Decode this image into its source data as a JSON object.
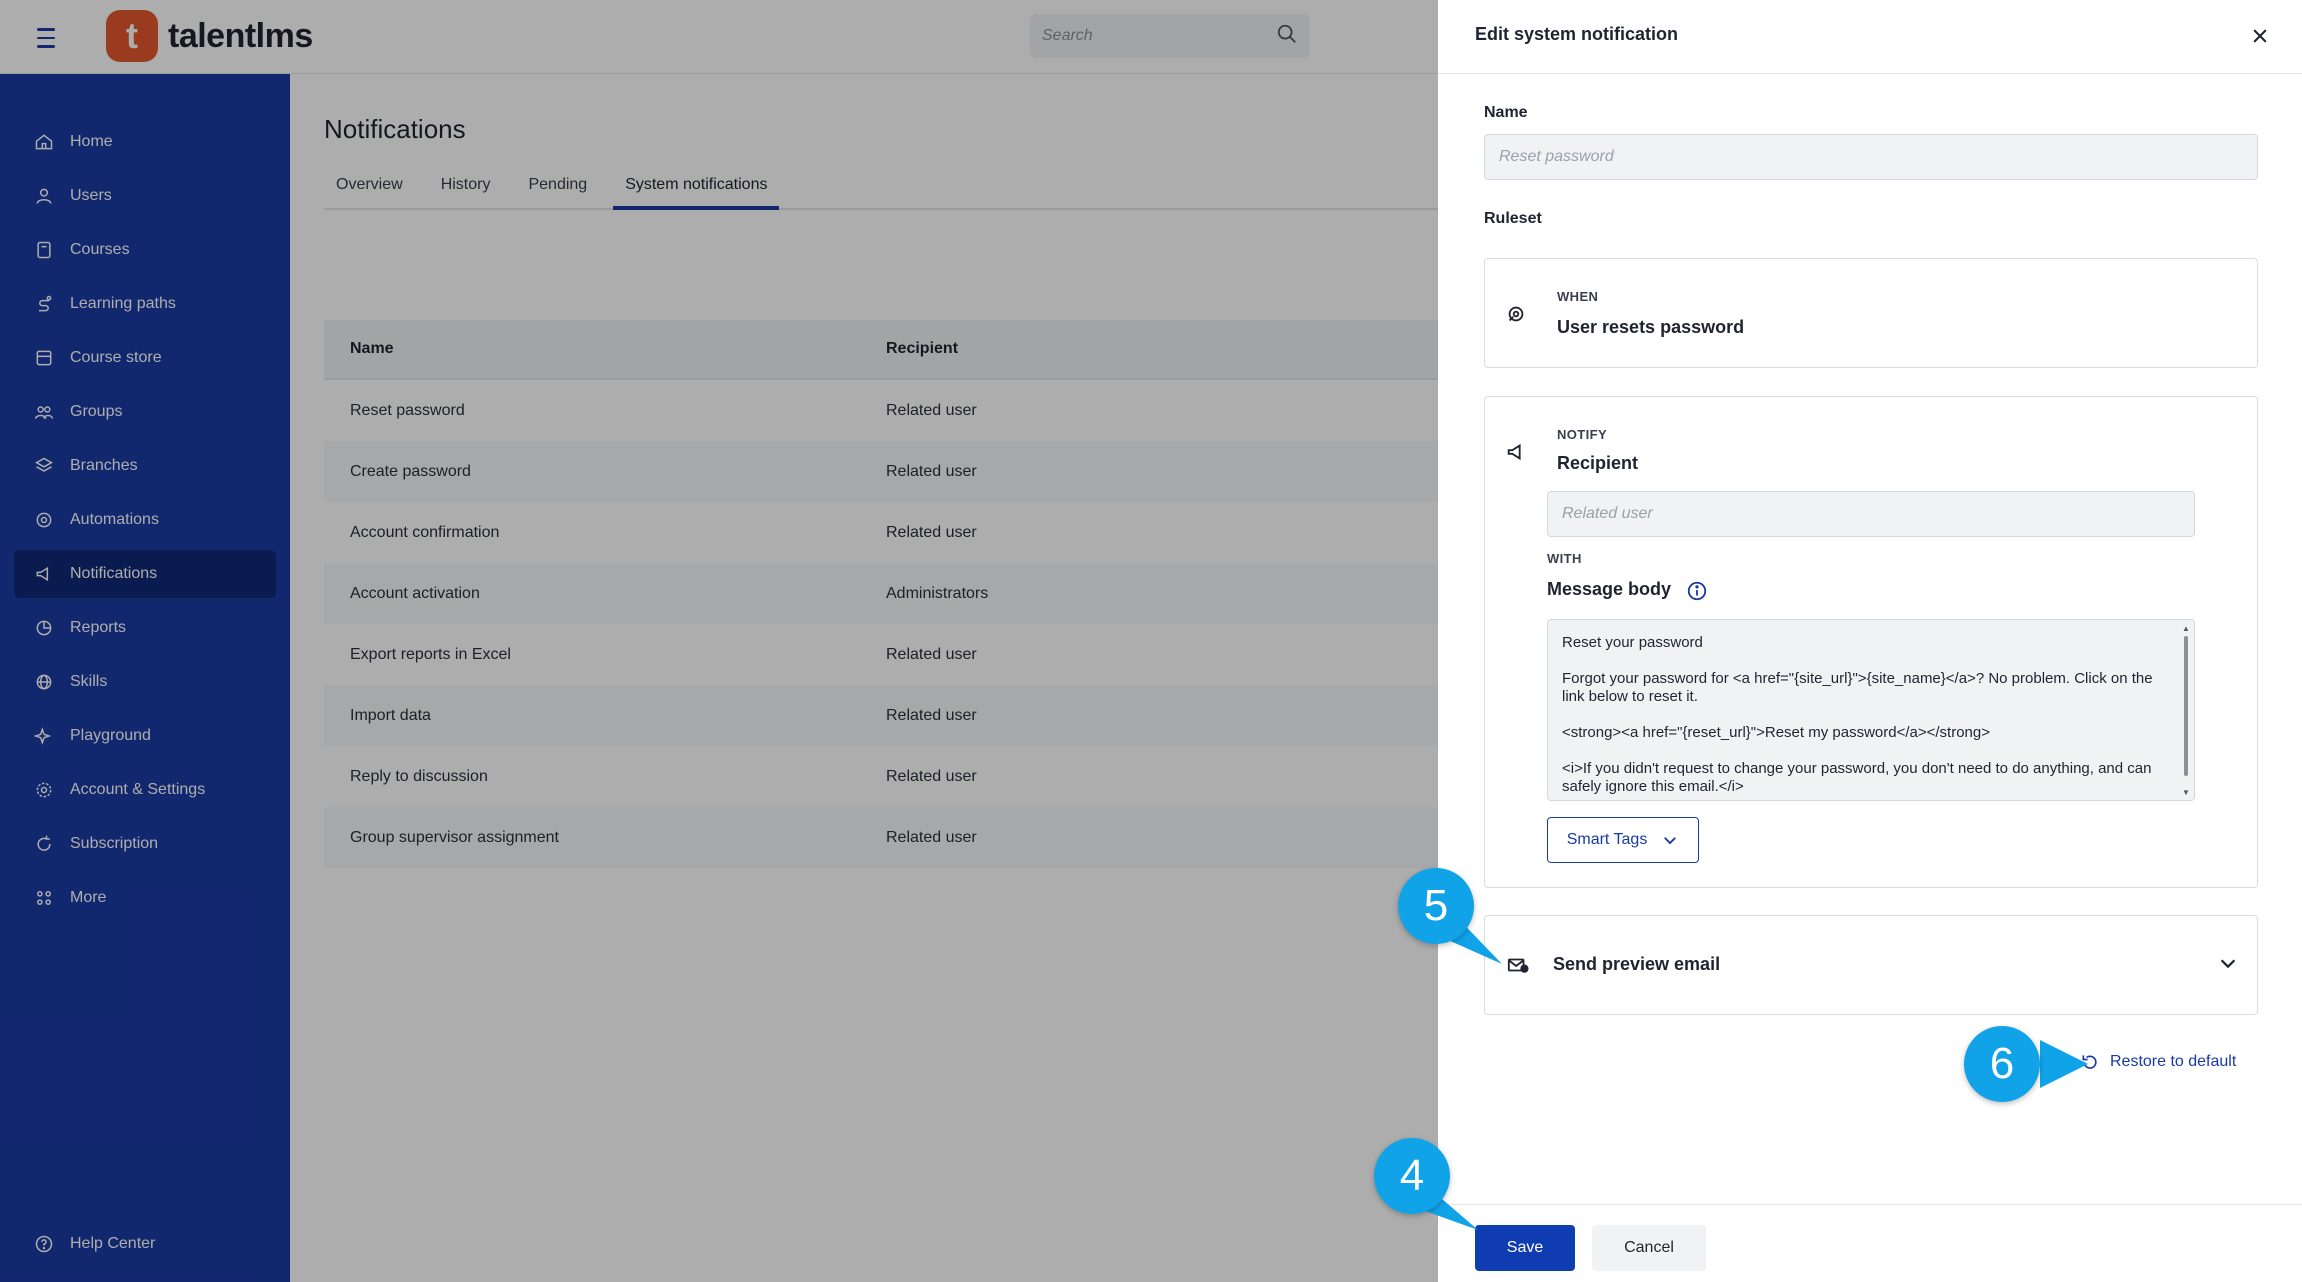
{
  "app": {
    "brand": "talentlms",
    "logo_letter": "t",
    "search_placeholder": "Search"
  },
  "sidebar": {
    "items": [
      {
        "label": "Home",
        "icon": "home-icon"
      },
      {
        "label": "Users",
        "icon": "user-icon"
      },
      {
        "label": "Courses",
        "icon": "book-icon"
      },
      {
        "label": "Learning paths",
        "icon": "path-icon"
      },
      {
        "label": "Course store",
        "icon": "store-icon"
      },
      {
        "label": "Groups",
        "icon": "groups-icon"
      },
      {
        "label": "Branches",
        "icon": "layers-icon"
      },
      {
        "label": "Automations",
        "icon": "automation-icon"
      },
      {
        "label": "Notifications",
        "icon": "megaphone-icon",
        "active": true
      },
      {
        "label": "Reports",
        "icon": "pie-chart-icon"
      },
      {
        "label": "Skills",
        "icon": "globe-icon"
      },
      {
        "label": "Playground",
        "icon": "sparkle-icon"
      },
      {
        "label": "Account & Settings",
        "icon": "gear-icon"
      },
      {
        "label": "Subscription",
        "icon": "refresh-icon"
      },
      {
        "label": "More",
        "icon": "grid-icon"
      }
    ],
    "help": "Help Center"
  },
  "main": {
    "title": "Notifications",
    "tabs": [
      "Overview",
      "History",
      "Pending",
      "System notifications"
    ],
    "active_tab": "System notifications",
    "table": {
      "headers": [
        "Name",
        "Recipient"
      ],
      "rows": [
        [
          "Reset password",
          "Related user"
        ],
        [
          "Create password",
          "Related user"
        ],
        [
          "Account confirmation",
          "Related user"
        ],
        [
          "Account activation",
          "Administrators"
        ],
        [
          "Export reports in Excel",
          "Related user"
        ],
        [
          "Import data",
          "Related user"
        ],
        [
          "Reply to discussion",
          "Related user"
        ],
        [
          "Group supervisor assignment",
          "Related user"
        ]
      ]
    }
  },
  "drawer": {
    "title": "Edit system notification",
    "name_label": "Name",
    "name_value": "Reset password",
    "ruleset_label": "Ruleset",
    "when_caption": "WHEN",
    "when_value": "User resets password",
    "notify_caption": "NOTIFY",
    "recipient_label": "Recipient",
    "recipient_value": "Related user",
    "with_caption": "WITH",
    "message_label": "Message body",
    "message_lines": [
      "Reset your password",
      "Forgot your password for <a href=\"{site_url}\">{site_name}</a>? No problem. Click on the link below to reset it.",
      "<strong><a href=\"{reset_url}\">Reset my password</a></strong>",
      "<i>If you didn't request to change your password, you don't need to do anything, and can safely ignore this email.</i>"
    ],
    "smart_tags": "Smart Tags",
    "preview_label": "Send preview email",
    "restore_label": "Restore to default",
    "save_label": "Save",
    "cancel_label": "Cancel"
  },
  "callouts": {
    "save": "4",
    "preview": "5",
    "restore": "6"
  },
  "colors": {
    "sidebar": "#1a3aa3",
    "sidebar_active": "#0f2877",
    "primary": "#0f3cb0",
    "callout": "#10a3e8",
    "logo": "#e4572e"
  }
}
